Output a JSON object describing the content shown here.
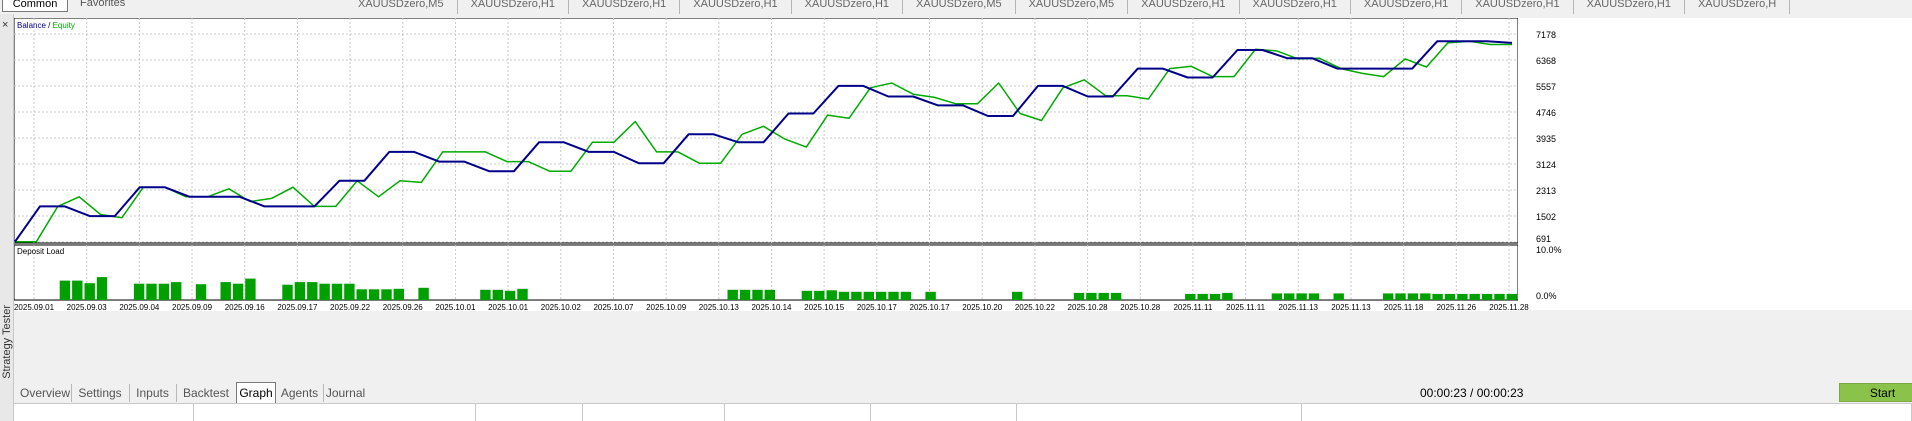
{
  "top_strip": {
    "common_label": "Common",
    "favorites_label": "Favorites",
    "symbol_tabs": [
      "XAUUSDzero,M5",
      "XAUUSDzero,H1",
      "XAUUSDzero,H1",
      "XAUUSDzero,H1",
      "XAUUSDzero,H1",
      "XAUUSDzero,M5",
      "XAUUSDzero,M5",
      "XAUUSDzero,H1",
      "XAUUSDzero,H1",
      "XAUUSDzero,H1",
      "XAUUSDzero,H1",
      "XAUUSDzero,H1",
      "XAUUSDzero,H"
    ]
  },
  "sidebar": {
    "close_label": "×",
    "label": "Strategy Tester"
  },
  "colors": {
    "balance": "#00008b",
    "equity": "#00aa00",
    "bars": "#00a000",
    "grid": "#c8c8c8",
    "start": "#8bc34a"
  },
  "chart_data": {
    "type": "line",
    "legend": {
      "balance": "Balance",
      "equity": "Equity",
      "separator": " / "
    },
    "y_ticks": [
      "7178",
      "6368",
      "5557",
      "4746",
      "3935",
      "3124",
      "2313",
      "1502",
      "691"
    ],
    "ylim": [
      691,
      7178
    ],
    "x_dates": [
      "2025.09.01",
      "2025.09.03",
      "2025.09.04",
      "2025.09.09",
      "2025.09.16",
      "2025.09.17",
      "2025.09.22",
      "2025.09.26",
      "2025.10.01",
      "2025.10.01",
      "2025.10.02",
      "2025.10.07",
      "2025.10.09",
      "2025.10.13",
      "2025.10.14",
      "2025.10.15",
      "2025.10.17",
      "2025.10.17",
      "2025.10.20",
      "2025.10.22",
      "2025.10.28",
      "2025.10.28",
      "2025.11.11",
      "2025.11.11",
      "2025.11.13",
      "2025.11.13",
      "2025.11.18",
      "2025.11.26",
      "2025.11.28"
    ],
    "balance": [
      [
        0,
        700
      ],
      [
        1,
        1800
      ],
      [
        2,
        1800
      ],
      [
        3,
        1500
      ],
      [
        4,
        1500
      ],
      [
        5,
        2400
      ],
      [
        6,
        2400
      ],
      [
        7,
        2100
      ],
      [
        8,
        2100
      ],
      [
        9,
        2100
      ],
      [
        10,
        1800
      ],
      [
        11,
        1800
      ],
      [
        12,
        1800
      ],
      [
        13,
        2600
      ],
      [
        14,
        2600
      ],
      [
        15,
        3500
      ],
      [
        16,
        3500
      ],
      [
        17,
        3200
      ],
      [
        18,
        3200
      ],
      [
        19,
        2900
      ],
      [
        20,
        2900
      ],
      [
        21,
        3800
      ],
      [
        22,
        3800
      ],
      [
        23,
        3500
      ],
      [
        24,
        3500
      ],
      [
        25,
        3150
      ],
      [
        26,
        3150
      ],
      [
        27,
        4050
      ],
      [
        28,
        4050
      ],
      [
        29,
        3800
      ],
      [
        30,
        3800
      ],
      [
        31,
        4700
      ],
      [
        32,
        4700
      ],
      [
        33,
        5560
      ],
      [
        34,
        5560
      ],
      [
        35,
        5230
      ],
      [
        36,
        5230
      ],
      [
        37,
        4950
      ],
      [
        38,
        4950
      ],
      [
        39,
        4620
      ],
      [
        40,
        4620
      ],
      [
        41,
        5560
      ],
      [
        42,
        5560
      ],
      [
        43,
        5230
      ],
      [
        44,
        5230
      ],
      [
        45,
        6100
      ],
      [
        46,
        6100
      ],
      [
        47,
        5820
      ],
      [
        48,
        5820
      ],
      [
        49,
        6680
      ],
      [
        50,
        6680
      ],
      [
        51,
        6420
      ],
      [
        52,
        6420
      ],
      [
        53,
        6100
      ],
      [
        54,
        6100
      ],
      [
        55,
        6100
      ],
      [
        56,
        6100
      ],
      [
        57,
        6950
      ],
      [
        58,
        6950
      ],
      [
        59,
        6950
      ],
      [
        60,
        6900
      ]
    ],
    "equity": [
      [
        0,
        700
      ],
      [
        1,
        700
      ],
      [
        2,
        1800
      ],
      [
        3,
        2100
      ],
      [
        4,
        1550
      ],
      [
        5,
        1450
      ],
      [
        6,
        2400
      ],
      [
        7,
        2400
      ],
      [
        8,
        2100
      ],
      [
        9,
        2100
      ],
      [
        10,
        2350
      ],
      [
        11,
        1950
      ],
      [
        12,
        2050
      ],
      [
        13,
        2400
      ],
      [
        14,
        1800
      ],
      [
        15,
        1800
      ],
      [
        16,
        2600
      ],
      [
        17,
        2100
      ],
      [
        18,
        2600
      ],
      [
        19,
        2550
      ],
      [
        20,
        3500
      ],
      [
        21,
        3500
      ],
      [
        22,
        3500
      ],
      [
        23,
        3200
      ],
      [
        24,
        3200
      ],
      [
        25,
        2900
      ],
      [
        26,
        2900
      ],
      [
        27,
        3800
      ],
      [
        28,
        3800
      ],
      [
        29,
        4450
      ],
      [
        30,
        3500
      ],
      [
        31,
        3500
      ],
      [
        32,
        3150
      ],
      [
        33,
        3150
      ],
      [
        34,
        4050
      ],
      [
        35,
        4300
      ],
      [
        36,
        3900
      ],
      [
        37,
        3650
      ],
      [
        38,
        4650
      ],
      [
        39,
        4550
      ],
      [
        40,
        5500
      ],
      [
        41,
        5650
      ],
      [
        42,
        5300
      ],
      [
        43,
        5200
      ],
      [
        44,
        5000
      ],
      [
        45,
        5000
      ],
      [
        46,
        5650
      ],
      [
        47,
        4700
      ],
      [
        48,
        4480
      ],
      [
        49,
        5500
      ],
      [
        50,
        5750
      ],
      [
        51,
        5250
      ],
      [
        52,
        5250
      ],
      [
        53,
        5150
      ],
      [
        54,
        6100
      ],
      [
        55,
        6170
      ],
      [
        56,
        5850
      ],
      [
        57,
        5850
      ],
      [
        58,
        6700
      ],
      [
        59,
        6650
      ],
      [
        60,
        6400
      ],
      [
        61,
        6420
      ],
      [
        62,
        6100
      ],
      [
        63,
        5950
      ],
      [
        64,
        5850
      ],
      [
        65,
        6400
      ],
      [
        66,
        6150
      ],
      [
        67,
        6900
      ],
      [
        68,
        6950
      ],
      [
        69,
        6850
      ],
      [
        70,
        6850
      ]
    ],
    "deposit_load": {
      "title": "Deposit Load",
      "y_ticks": [
        "10.0%",
        "0.0%"
      ],
      "ylim": [
        0,
        10
      ],
      "values": [
        0,
        0,
        3.8,
        3.8,
        3.3,
        4.5,
        0,
        0,
        3.2,
        3.2,
        3.2,
        3.5,
        0,
        3.1,
        0,
        3.5,
        3.2,
        4.2,
        0,
        0,
        3.0,
        3.5,
        3.5,
        3.2,
        3.2,
        3.2,
        2.1,
        2.1,
        2.1,
        2.2,
        0,
        2.4,
        0,
        0,
        0,
        0,
        2.0,
        2.0,
        1.8,
        2.2,
        0,
        0,
        0,
        0,
        0,
        0,
        0,
        0,
        0,
        0,
        0,
        0,
        0,
        0,
        0,
        0,
        2.0,
        2.0,
        2.0,
        2.0,
        0,
        0,
        1.8,
        1.8,
        1.9,
        1.6,
        1.6,
        1.6,
        1.6,
        1.6,
        1.6,
        0,
        1.6,
        0,
        0,
        0,
        0,
        0,
        0,
        1.6,
        0,
        0,
        0,
        0,
        1.4,
        1.4,
        1.4,
        1.4,
        0,
        0,
        0,
        0,
        0,
        1.2,
        1.2,
        1.2,
        1.4,
        0,
        0,
        0,
        1.3,
        1.3,
        1.3,
        1.3,
        0,
        1.3,
        0,
        0,
        0,
        1.3,
        1.3,
        1.3,
        1.3,
        1.2,
        1.2,
        1.2,
        1.2,
        1.2,
        1.2,
        1.2
      ]
    }
  },
  "bottom_tabs": [
    "Overview",
    "Settings",
    "Inputs",
    "Backtest",
    "Graph",
    "Agents",
    "Journal"
  ],
  "active_tab": "Graph",
  "timer": "00:00:23 / 00:00:23",
  "start_label": "Start"
}
